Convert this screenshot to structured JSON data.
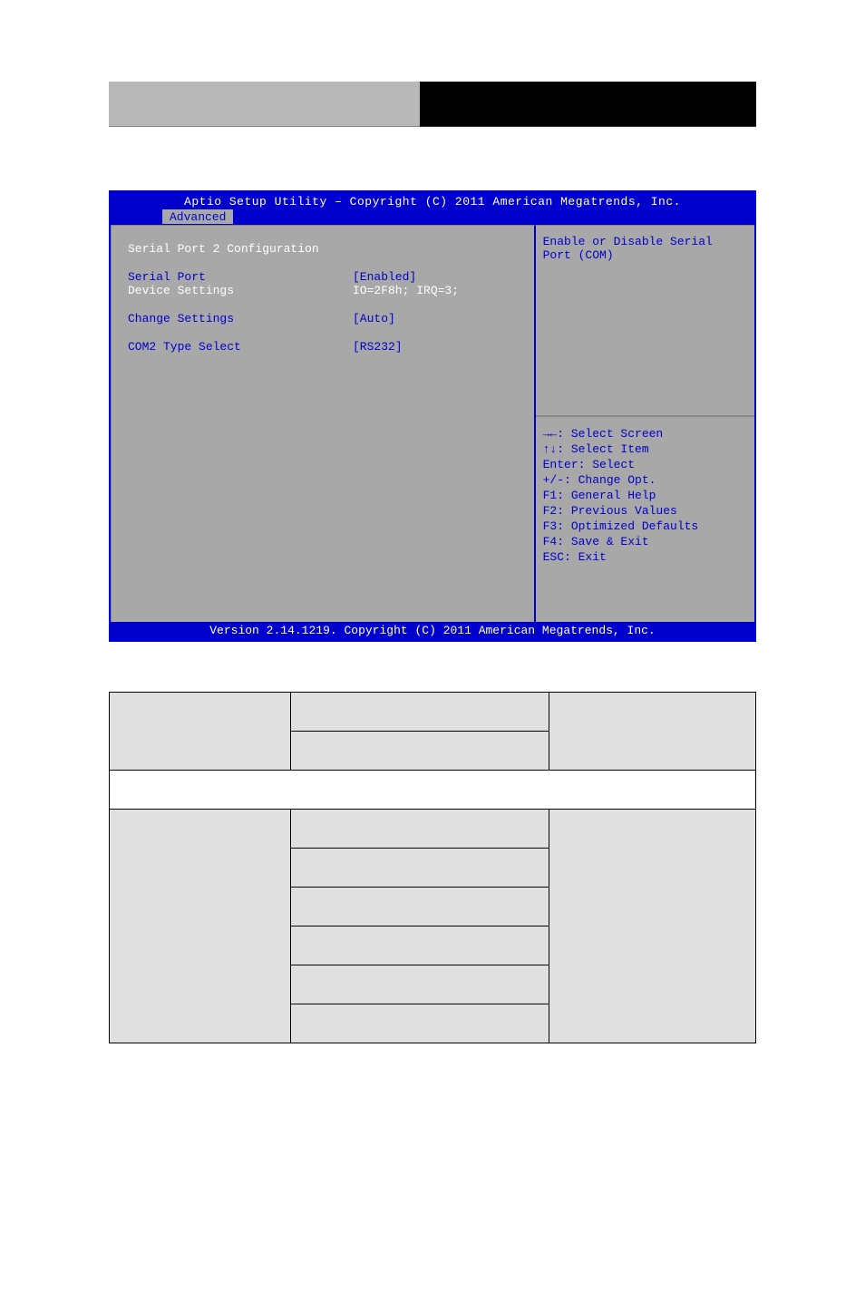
{
  "bios": {
    "title": "Aptio Setup Utility – Copyright (C) 2011 American Megatrends, Inc.",
    "tab": "Advanced",
    "heading": "Serial Port 2 Configuration",
    "items": {
      "serial_port": {
        "label": "Serial Port",
        "value": "[Enabled]"
      },
      "device_settings": {
        "label": "Device Settings",
        "value": "IO=2F8h; IRQ=3;"
      },
      "change_settings": {
        "label": "Change Settings",
        "value": "[Auto]"
      },
      "com2_type": {
        "label": "COM2 Type Select",
        "value": "[RS232]"
      }
    },
    "help_text": "Enable or Disable Serial Port (COM)",
    "keys": [
      "→←: Select Screen",
      "↑↓: Select Item",
      "Enter: Select",
      "+/-: Change Opt.",
      "F1: General Help",
      "F2: Previous Values",
      "F3: Optimized Defaults",
      "F4: Save & Exit",
      "ESC: Exit"
    ],
    "footer": "Version 2.14.1219. Copyright (C) 2011 American Megatrends, Inc."
  }
}
